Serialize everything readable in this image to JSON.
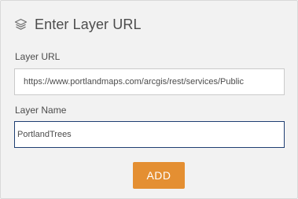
{
  "header": {
    "icon": "layers-icon",
    "title": "Enter Layer URL"
  },
  "layer_url": {
    "label": "Layer URL",
    "value": "https://www.portlandmaps.com/arcgis/rest/services/Public"
  },
  "layer_name": {
    "label": "Layer Name",
    "value": "PortlandTrees"
  },
  "add_button": {
    "label": "ADD"
  },
  "colors": {
    "panel_background": "#f2f2f2",
    "accent_button": "#e48f32",
    "focus_border": "#1f3f72",
    "text": "#4c4c4c"
  }
}
